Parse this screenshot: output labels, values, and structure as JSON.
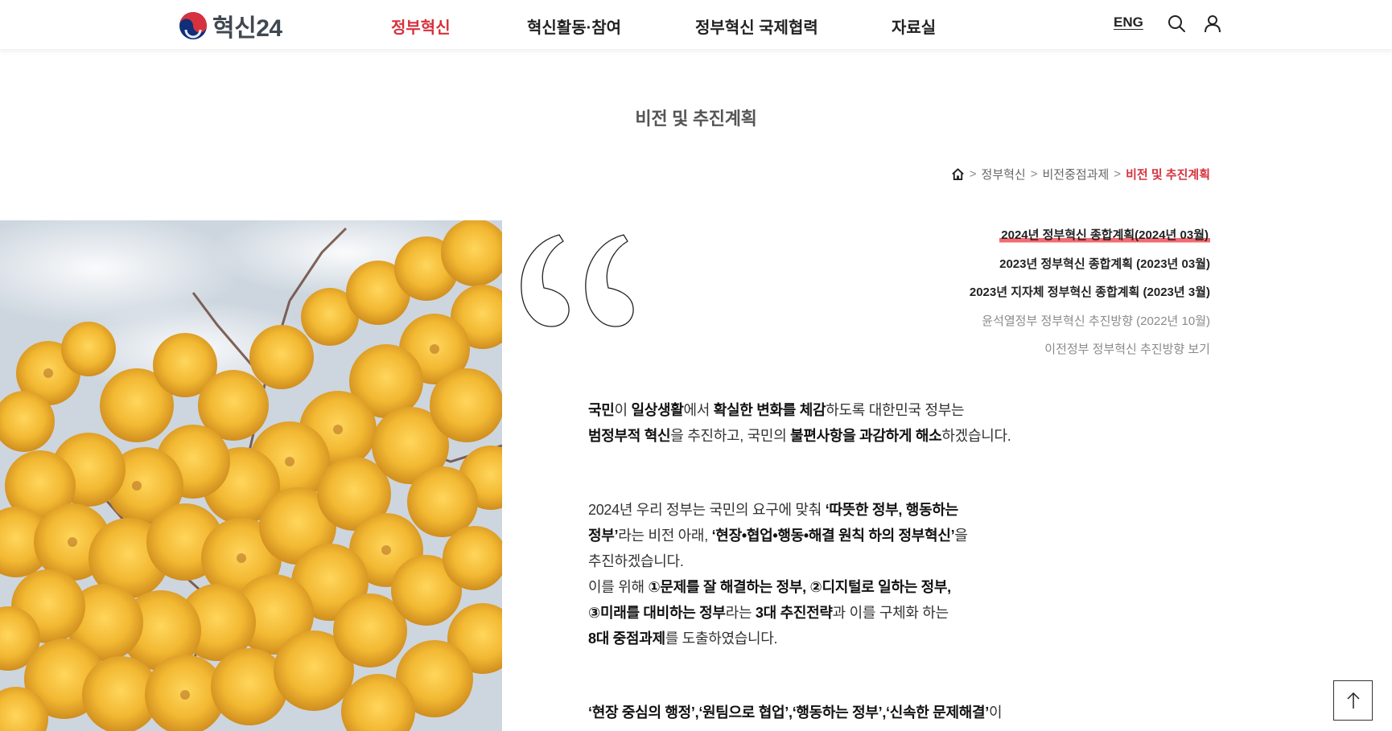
{
  "header": {
    "logo_text": "혁신24",
    "nav": [
      "정부혁신",
      "혁신활동·참여",
      "정부혁신 국제협력",
      "자료실"
    ],
    "active_nav": "정부혁신",
    "lang_label": "ENG",
    "icons": [
      "search-icon",
      "user-icon"
    ]
  },
  "page": {
    "title": "비전 및 추진계획",
    "breadcrumb": [
      "정부혁신",
      "비전중점과제",
      "비전 및 추진계획"
    ],
    "breadcrumb_sep": ">"
  },
  "plan_links": [
    "2024년 정부혁신 종합계획(2024년 03월)",
    "2023년 정부혁신 종합계획 (2023년 03월)",
    "2023년 지자체 정부혁신 종합계획 (2023년 3월)",
    "윤석열정부 정부혁신 추진방향 (2022년 10월)",
    "이전정부 정부혁신 추진방향 보기"
  ],
  "content": {
    "p1": [
      {
        "t": "국민",
        "b": true
      },
      {
        "t": "이 ",
        "b": false
      },
      {
        "t": "일상생활",
        "b": true
      },
      {
        "t": "에서 ",
        "b": false
      },
      {
        "t": "확실한 변화를 체감",
        "b": true
      },
      {
        "t": "하도록 대한민국 정부는",
        "b": false
      },
      {
        "br": true
      },
      {
        "t": "범정부적 혁신",
        "b": true
      },
      {
        "t": "을 추진하고, 국민의 ",
        "b": false
      },
      {
        "t": "불편사항을 과감하게 해소",
        "b": true
      },
      {
        "t": "하겠습니다.",
        "b": false
      }
    ],
    "p2": [
      {
        "t": "2024년 우리 정부는 국민의 요구에 맞춰 ",
        "b": false
      },
      {
        "t": "‘따뜻한 정부, 행동하는",
        "b": true
      },
      {
        "br": true
      },
      {
        "t": "정부’",
        "b": true
      },
      {
        "t": "라는 비전 아래, ",
        "b": false
      },
      {
        "t": "‘현장•협업•행동•해결 원칙 하의 정부혁신’",
        "b": true
      },
      {
        "t": "을",
        "b": false
      },
      {
        "br": true
      },
      {
        "t": "추진하겠습니다.",
        "b": false
      },
      {
        "br": true
      },
      {
        "t": "이를 위해 ",
        "b": false
      },
      {
        "t": "①문제를 잘 해결하는 정부, ②디지털로 일하는 정부,",
        "b": true
      },
      {
        "br": true
      },
      {
        "t": "③미래를 대비하는 정부",
        "b": true
      },
      {
        "t": "라는 ",
        "b": false
      },
      {
        "t": "3대 추진전략",
        "b": true
      },
      {
        "t": "과 이를 구체화 하는",
        "b": false
      },
      {
        "br": true
      },
      {
        "t": "8대 중점과제",
        "b": true
      },
      {
        "t": "를 도출하였습니다.",
        "b": false
      }
    ],
    "p3": [
      {
        "t": "‘현장 중심의 행정’,‘원팀으로 협업’,‘행동하는 정부’,‘신속한 문제해결’",
        "b": true
      },
      {
        "t": "이",
        "b": false
      }
    ]
  },
  "colors": {
    "accent": "#d6323d",
    "highlight": "#f46a6f",
    "text": "#222222",
    "muted": "#8a8a8a"
  }
}
